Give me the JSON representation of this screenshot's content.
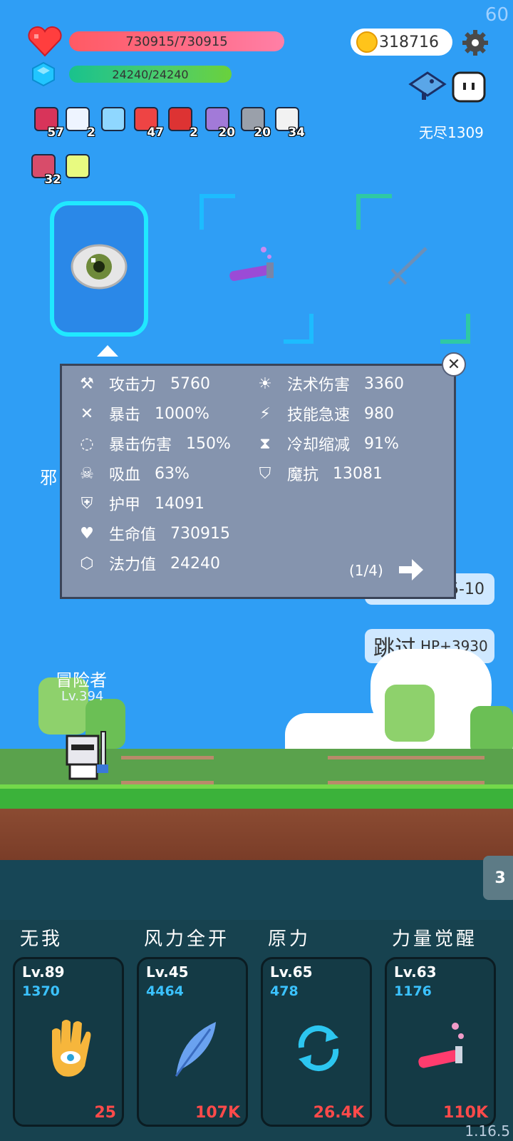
{
  "hud": {
    "fps": "60",
    "hp_text": "730915/730915",
    "mp_text": "24240/24240",
    "coins": "318716",
    "endless_label": "无尽1309",
    "version": "1.16.5"
  },
  "items": [
    {
      "icon": "jam-jar-icon",
      "count": "57"
    },
    {
      "icon": "cloud-icon",
      "count": "2"
    },
    {
      "icon": "magnifier-icon",
      "count": ""
    },
    {
      "icon": "sock-icon",
      "count": "47"
    },
    {
      "icon": "magnet-icon",
      "count": "2"
    },
    {
      "icon": "shield-star-icon",
      "count": "20"
    },
    {
      "icon": "compass-icon",
      "count": "20"
    },
    {
      "icon": "cards-icon",
      "count": "34"
    },
    {
      "icon": "sword-card-icon",
      "count": "32"
    },
    {
      "icon": "lightbulb-icon",
      "count": ""
    }
  ],
  "stats": {
    "left": [
      {
        "icon": "axe-icon",
        "label": "攻击力",
        "value": "5760"
      },
      {
        "icon": "crit-icon",
        "label": "暴击",
        "value": "1000%"
      },
      {
        "icon": "crit-damage-icon",
        "label": "暴击伤害",
        "value": "150%"
      },
      {
        "icon": "skull-icon",
        "label": "吸血",
        "value": "63%"
      },
      {
        "icon": "armor-icon",
        "label": "护甲",
        "value": "14091"
      },
      {
        "icon": "heart-icon",
        "label": "生命值",
        "value": "730915"
      },
      {
        "icon": "mana-crystal-icon",
        "label": "法力值",
        "value": "24240"
      }
    ],
    "right": [
      {
        "icon": "sun-icon",
        "label": "法术伤害",
        "value": "3360"
      },
      {
        "icon": "lightning-icon",
        "label": "技能急速",
        "value": "980"
      },
      {
        "icon": "hourglass-icon",
        "label": "冷却缩减",
        "value": "91%"
      },
      {
        "icon": "magic-shield-icon",
        "label": "魔抗",
        "value": "13081"
      }
    ],
    "page": "(1/4)"
  },
  "side": {
    "partial_left": "邪",
    "hidden_btn": "5-10",
    "skip": "跳过",
    "hp_gain": "HP+3930",
    "stage_tab": "3"
  },
  "player": {
    "name": "冒险者",
    "level": "Lv.394"
  },
  "skills": [
    {
      "title": "无我",
      "lv": "Lv.89",
      "num": "1370",
      "cost": "25",
      "icon": "eye-hand-icon"
    },
    {
      "title": "风力全开",
      "lv": "Lv.45",
      "num": "4464",
      "cost": "107K",
      "icon": "feather-icon"
    },
    {
      "title": "原力",
      "lv": "Lv.65",
      "num": "478",
      "cost": "26.4K",
      "icon": "cycle-icon"
    },
    {
      "title": "力量觉醒",
      "lv": "Lv.63",
      "num": "1176",
      "cost": "110K",
      "icon": "potion-icon"
    }
  ]
}
